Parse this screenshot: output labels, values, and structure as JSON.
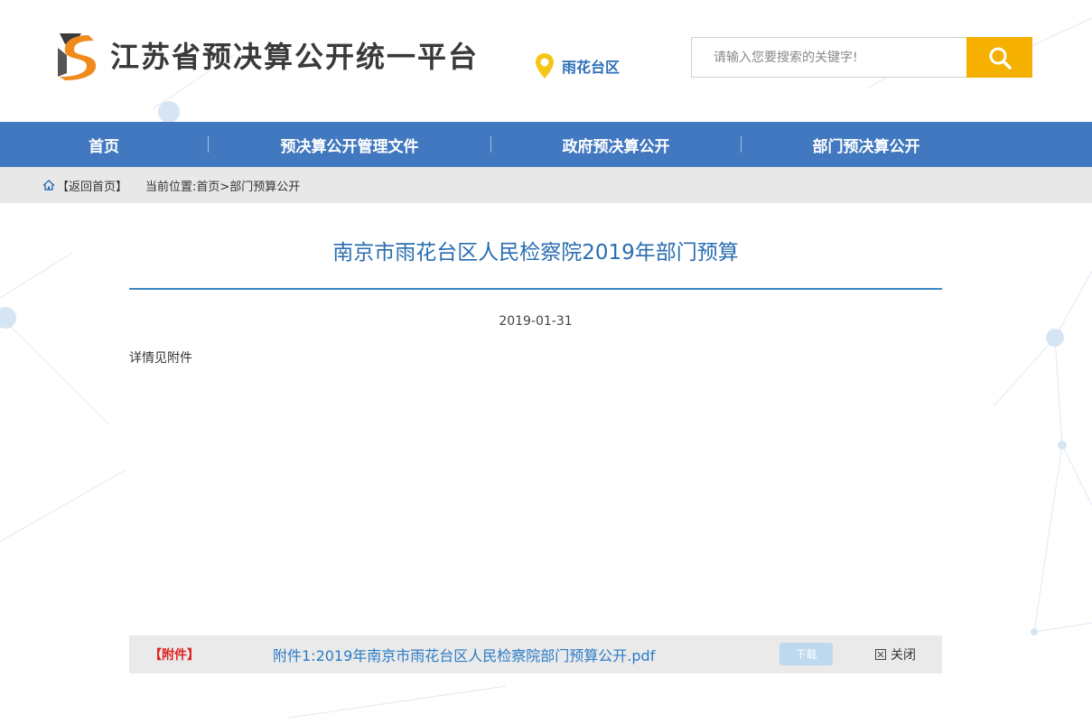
{
  "header": {
    "site_title": "江苏省预决算公开统一平台",
    "region": "雨花台区",
    "search": {
      "placeholder": "请输入您要搜索的关键字!"
    }
  },
  "nav": {
    "items": [
      {
        "label": "首页"
      },
      {
        "label": "预决算公开管理文件"
      },
      {
        "label": "政府预决算公开"
      },
      {
        "label": "部门预决算公开"
      }
    ]
  },
  "breadcrumb": {
    "back_label": "【返回首页】",
    "current_label": "当前位置:",
    "path": "首页>部门预算公开"
  },
  "article": {
    "title": "南京市雨花台区人民检察院2019年部门预算",
    "date": "2019-01-31",
    "body": "详情见附件"
  },
  "attachment": {
    "tag": "【附件】",
    "link": "附件1:2019年南京市雨花台区人民检察院部门预算公开.pdf",
    "download_label": "下载",
    "close_label": "关闭"
  },
  "colors": {
    "nav_bg": "#4178bf",
    "accent_orange": "#f6b000",
    "title_blue": "#2a6db0",
    "attach_tag_red": "#e02020"
  },
  "icons": [
    "logo-mark-icon",
    "location-pin-icon",
    "search-icon",
    "home-icon",
    "close-box-icon"
  ]
}
